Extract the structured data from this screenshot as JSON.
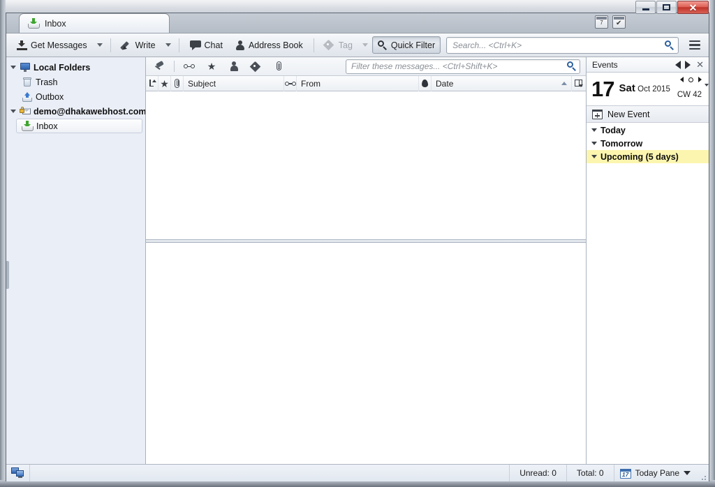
{
  "window": {
    "controls": {
      "minimize": "minimize-button",
      "restore": "restore-button",
      "close": "✕"
    },
    "titlebar_icons": [
      {
        "name": "calendar-icon",
        "day": "7"
      },
      {
        "name": "tasks-icon",
        "glyph": "✔"
      }
    ]
  },
  "tab": {
    "label": "Inbox",
    "icon": "inbox-tray-icon"
  },
  "toolbar": {
    "get_messages": "Get Messages",
    "write": "Write",
    "chat": "Chat",
    "address_book": "Address Book",
    "tag": "Tag",
    "quick_filter": "Quick Filter",
    "search_placeholder": "Search... <Ctrl+K>",
    "search_value": "",
    "menu": "app-menu"
  },
  "folder_pane": {
    "items": [
      {
        "label": "Local Folders",
        "icon": "monitor-icon",
        "level": 0,
        "bold": true,
        "expanded": true,
        "selected": false
      },
      {
        "label": "Trash",
        "icon": "trash-icon",
        "level": 1,
        "bold": false,
        "expanded": false,
        "selected": false
      },
      {
        "label": "Outbox",
        "icon": "outbox-icon",
        "level": 1,
        "bold": false,
        "expanded": false,
        "selected": false
      },
      {
        "label": "demo@dhakawebhost.com",
        "icon": "account-lock-icon",
        "level": 0,
        "bold": true,
        "expanded": true,
        "selected": false
      },
      {
        "label": "Inbox",
        "icon": "inbox-tray-icon",
        "level": 1,
        "bold": false,
        "expanded": false,
        "selected": true
      }
    ]
  },
  "quick_filter_bar": {
    "icons": [
      "pin-icon",
      "unread-glasses-icon",
      "starred-icon",
      "contact-icon",
      "tag-icon",
      "attachment-icon"
    ],
    "filter_placeholder": "Filter these messages... <Ctrl+Shift+K>",
    "filter_value": ""
  },
  "message_list": {
    "columns": [
      {
        "label": "",
        "name": "thread-column",
        "icon": "thread-icon"
      },
      {
        "label": "",
        "name": "star-column",
        "icon": "star-icon"
      },
      {
        "label": "",
        "name": "attachment-column",
        "icon": "paperclip-icon"
      },
      {
        "label": "Subject",
        "name": "subject-column",
        "icon": ""
      },
      {
        "label": "",
        "name": "read-column",
        "icon": "glasses-icon"
      },
      {
        "label": "From",
        "name": "from-column",
        "icon": ""
      },
      {
        "label": "",
        "name": "junk-column",
        "icon": "flame-icon"
      },
      {
        "label": "Date",
        "name": "date-column",
        "icon": ""
      }
    ],
    "rows": [],
    "sorted_by": "Date",
    "sort_direction": "ascending"
  },
  "today_pane": {
    "header_title": "Events",
    "close_label": "✕",
    "date": {
      "day": "17",
      "weekday": "Sat",
      "month_year": "Oct 2015",
      "calendar_week": "CW 42"
    },
    "new_event_label": "New Event",
    "groups": [
      {
        "label": "Today",
        "highlighted": false
      },
      {
        "label": "Tomorrow",
        "highlighted": false
      },
      {
        "label": "Upcoming (5 days)",
        "highlighted": true
      }
    ]
  },
  "statusbar": {
    "unread": "Unread: 0",
    "total": "Total: 0",
    "today_pane_label": "Today Pane",
    "today_pane_day": "17",
    "network_icon": "network-icon"
  },
  "colors": {
    "accent": "#2d5f9e",
    "highlight": "#fcf5af",
    "folder_pane_bg": "#eaeef6",
    "close_button": "#c0342a"
  }
}
